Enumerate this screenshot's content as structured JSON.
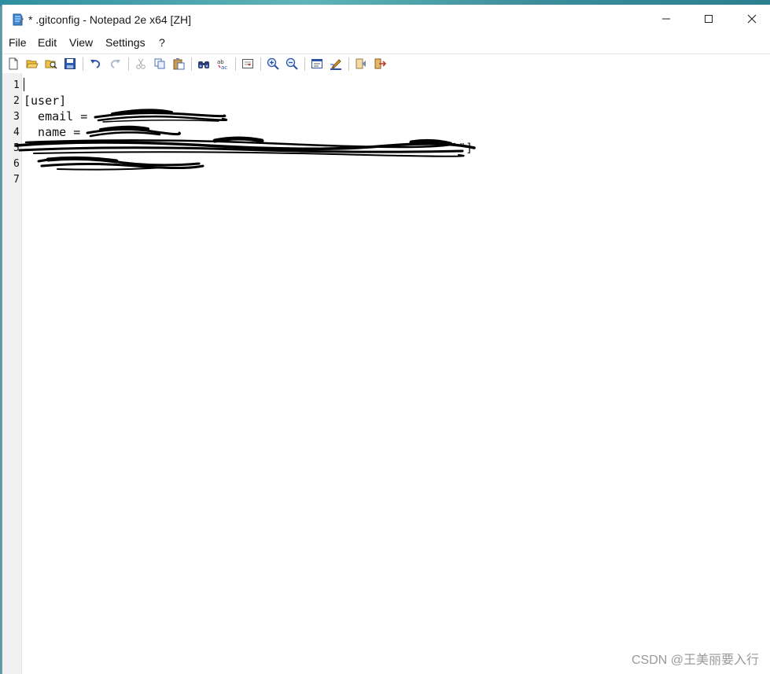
{
  "window": {
    "title": "* .gitconfig - Notepad 2e x64 [ZH]",
    "controls": [
      "minimize-icon",
      "maximize-icon",
      "close-icon"
    ]
  },
  "menu": [
    "File",
    "Edit",
    "View",
    "Settings",
    "?"
  ],
  "toolbar": [
    "new-file-icon",
    "open-folder-icon",
    "browse-icon",
    "save-icon",
    "undo-icon",
    "redo-icon",
    "cut-icon",
    "copy-icon",
    "paste-icon",
    "find-icon",
    "replace-icon",
    "goto-icon",
    "zoom-in-icon",
    "zoom-out-icon",
    "schemes-icon",
    "customize-icon",
    "favorites-icon",
    "exit-icon"
  ],
  "editor": {
    "line_numbers": [
      "1",
      "2",
      "3",
      "4",
      "5",
      "6",
      "7"
    ],
    "lines": [
      "",
      "[user]",
      "  email = ",
      "  name = ",
      "",
      "",
      ""
    ],
    "line5_fragment": "\"]"
  },
  "watermark": "CSDN @王美丽要入行",
  "colors": {
    "scribble": "#000000",
    "gutter": "#f0f0f0"
  }
}
